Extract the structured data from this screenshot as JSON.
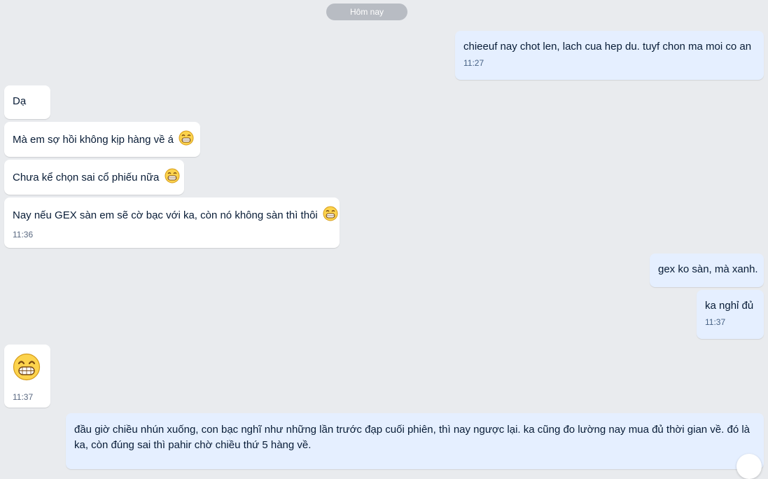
{
  "date_separator": "Hôm nay",
  "messages": [
    {
      "id": "m1",
      "direction": "out",
      "text": "chieeuf nay chot len, lach cua hep du. tuyf chon ma moi co an",
      "time": "11:27"
    },
    {
      "id": "m2",
      "direction": "in",
      "text": "Dạ",
      "time": ""
    },
    {
      "id": "m3",
      "direction": "in",
      "text": "Mà em sợ hồi không kịp hàng về á",
      "emoji": "grin-emoji",
      "time": ""
    },
    {
      "id": "m4",
      "direction": "in",
      "text": "Chưa kể chọn sai cổ phiếu nữa",
      "emoji": "grin-emoji",
      "time": ""
    },
    {
      "id": "m5",
      "direction": "in",
      "text": "Nay nếu GEX sàn em sẽ cờ bạc với ka, còn nó không sàn thì thôi",
      "emoji": "grin-emoji",
      "time": "11:36"
    },
    {
      "id": "m6",
      "direction": "out",
      "text": "gex ko sàn, mà xanh.",
      "time": ""
    },
    {
      "id": "m7",
      "direction": "out",
      "text": "ka nghỉ đủ",
      "time": "11:37"
    },
    {
      "id": "m8",
      "direction": "in",
      "text": "",
      "emoji": "grin-emoji-large",
      "time": "11:37"
    },
    {
      "id": "m9",
      "direction": "out",
      "text": "đầu giờ chiều nhún xuống, con bạc nghĩ như những lần trước đạp cuối phiên, thì nay ngược lại. ka cũng đo lường nay mua đủ thời gian về. đó là ka, còn đúng sai thì pahir chờ chiều thứ 5 hàng về.",
      "time": ""
    }
  ],
  "colors": {
    "background": "#e9ebee",
    "incoming_bubble": "#ffffff",
    "outgoing_bubble": "#e5efff",
    "text": "#081c36",
    "time_text": "#476285",
    "date_pill": "#b8bcc3"
  }
}
